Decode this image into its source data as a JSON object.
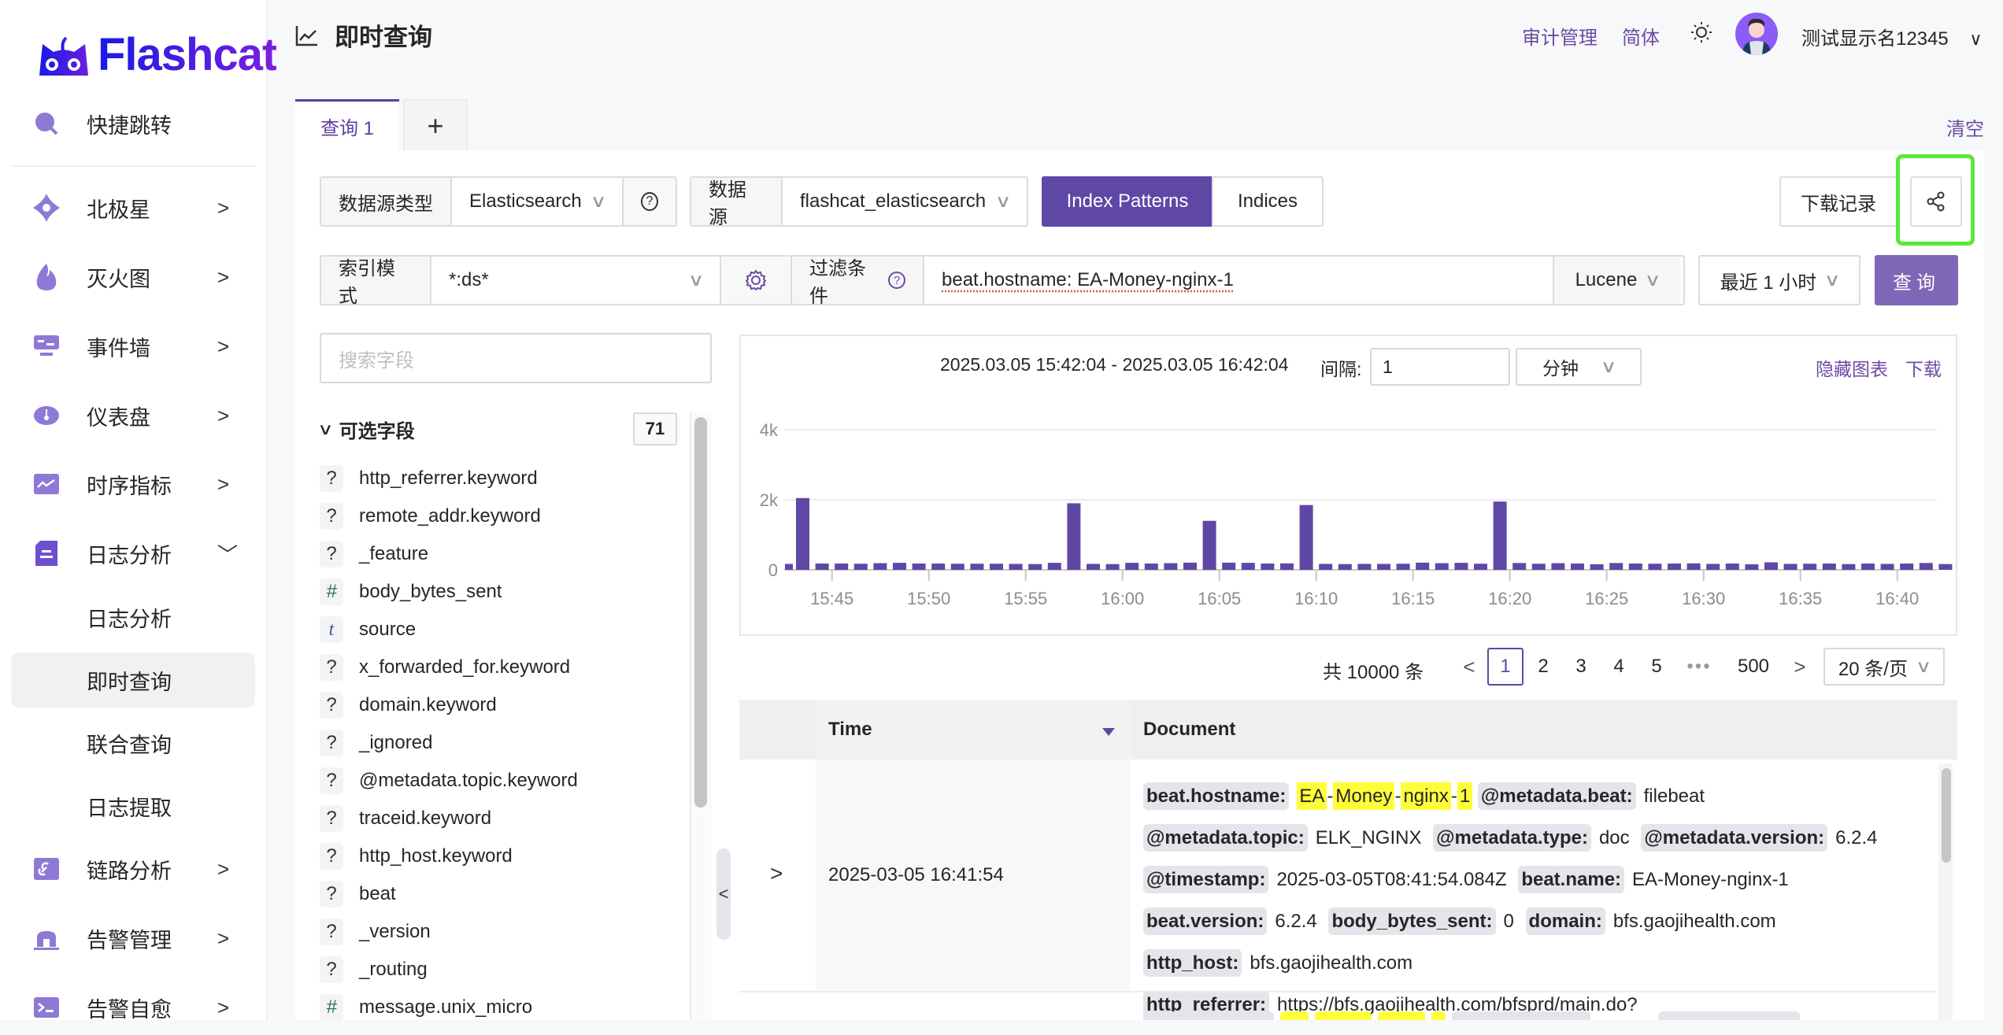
{
  "brand": {
    "name": "Flashcat"
  },
  "sidebar": {
    "items": [
      {
        "label": "快捷跳转",
        "icon": "search-icon"
      },
      {
        "label": "北极星",
        "icon": "polestar-icon",
        "chevron": ">"
      },
      {
        "label": "灭火图",
        "icon": "flame-icon",
        "chevron": ">"
      },
      {
        "label": "事件墙",
        "icon": "event-wall-icon",
        "chevron": ">"
      },
      {
        "label": "仪表盘",
        "icon": "dashboard-icon",
        "chevron": ">"
      },
      {
        "label": "时序指标",
        "icon": "metrics-icon",
        "chevron": ">"
      },
      {
        "label": "日志分析",
        "icon": "log-icon",
        "chevron": "﹀"
      },
      {
        "label": "链路分析",
        "icon": "link-icon",
        "chevron": ">"
      },
      {
        "label": "告警管理",
        "icon": "alarm-icon",
        "chevron": ">"
      },
      {
        "label": "告警自愈",
        "icon": "terminal-icon",
        "chevron": ">"
      }
    ],
    "log_sub_items": [
      {
        "label": "日志分析",
        "active": false
      },
      {
        "label": "即时查询",
        "active": true
      },
      {
        "label": "联合查询",
        "active": false
      },
      {
        "label": "日志提取",
        "active": false
      }
    ]
  },
  "header": {
    "title": "即时查询",
    "audit_link": "审计管理",
    "language": "简体",
    "username": "测试显示名12345",
    "user_chevron": "∨"
  },
  "tabs": {
    "items": [
      {
        "label": "查询 1",
        "active": true
      }
    ],
    "add_label": "+",
    "clear_label": "清空"
  },
  "query": {
    "datasource_type_label": "数据源类型",
    "datasource_type_value": "Elasticsearch",
    "help_icon": "?",
    "datasource_label": "数据源",
    "datasource_value": "flashcat_elasticsearch",
    "mode_options": [
      {
        "label": "Index Patterns",
        "active": true
      },
      {
        "label": "Indices",
        "active": false
      }
    ],
    "download_records_label": "下载记录",
    "share_icon": "share-icon",
    "index_pattern_label": "索引模式",
    "index_pattern_value": "*:ds*",
    "filter_label": "过滤条件",
    "filter_value": "beat.hostname: EA-Money-nginx-1",
    "syntax_value": "Lucene",
    "time_range_value": "最近 1 小时",
    "query_button": "查询"
  },
  "fields": {
    "search_placeholder": "搜索字段",
    "section_label": "可选字段",
    "count": "71",
    "items": [
      {
        "type": "?",
        "type_class": "unk",
        "name": "http_referrer.keyword"
      },
      {
        "type": "?",
        "type_class": "unk",
        "name": "remote_addr.keyword"
      },
      {
        "type": "?",
        "type_class": "unk",
        "name": "_feature"
      },
      {
        "type": "#",
        "type_class": "num",
        "name": "body_bytes_sent"
      },
      {
        "type": "t",
        "type_class": "txt",
        "name": "source"
      },
      {
        "type": "?",
        "type_class": "unk",
        "name": "x_forwarded_for.keyword"
      },
      {
        "type": "?",
        "type_class": "unk",
        "name": "domain.keyword"
      },
      {
        "type": "?",
        "type_class": "unk",
        "name": "_ignored"
      },
      {
        "type": "?",
        "type_class": "unk",
        "name": "@metadata.topic.keyword"
      },
      {
        "type": "?",
        "type_class": "unk",
        "name": "traceid.keyword"
      },
      {
        "type": "?",
        "type_class": "unk",
        "name": "http_host.keyword"
      },
      {
        "type": "?",
        "type_class": "unk",
        "name": "beat"
      },
      {
        "type": "?",
        "type_class": "unk",
        "name": "_version"
      },
      {
        "type": "?",
        "type_class": "unk",
        "name": "_routing"
      },
      {
        "type": "#",
        "type_class": "num",
        "name": "message.unix_micro"
      }
    ]
  },
  "histogram": {
    "range_text": "2025.03.05 15:42:04 - 2025.03.05 16:42:04",
    "interval_label": "间隔:",
    "interval_value": "1",
    "interval_unit": "分钟",
    "hide_chart_label": "隐藏图表",
    "download_label": "下载"
  },
  "chart_data": {
    "type": "bar",
    "title": "",
    "xlabel": "",
    "ylabel": "",
    "ylim": [
      0,
      4000
    ],
    "yticks": [
      "0",
      "2k",
      "4k"
    ],
    "ytick_values": [
      0,
      2000,
      4000
    ],
    "xticks": [
      "15:45",
      "15:50",
      "15:55",
      "16:00",
      "16:05",
      "16:10",
      "16:15",
      "16:20",
      "16:25",
      "16:30",
      "16:35",
      "16:40"
    ],
    "bar_color": "#5f48a5",
    "grid": true,
    "categories": [
      "15:42",
      "15:43",
      "15:44",
      "15:45",
      "15:46",
      "15:47",
      "15:48",
      "15:49",
      "15:50",
      "15:51",
      "15:52",
      "15:53",
      "15:54",
      "15:55",
      "15:56",
      "15:57",
      "15:58",
      "15:59",
      "16:00",
      "16:01",
      "16:02",
      "16:03",
      "16:04",
      "16:05",
      "16:06",
      "16:07",
      "16:08",
      "16:09",
      "16:10",
      "16:11",
      "16:12",
      "16:13",
      "16:14",
      "16:15",
      "16:16",
      "16:17",
      "16:18",
      "16:19",
      "16:20",
      "16:21",
      "16:22",
      "16:23",
      "16:24",
      "16:25",
      "16:26",
      "16:27",
      "16:28",
      "16:29",
      "16:30",
      "16:31",
      "16:32",
      "16:33",
      "16:34",
      "16:35",
      "16:36",
      "16:37",
      "16:38",
      "16:39",
      "16:40",
      "16:41"
    ],
    "values": [
      170,
      2050,
      180,
      180,
      175,
      190,
      200,
      180,
      180,
      175,
      175,
      175,
      170,
      165,
      200,
      1900,
      170,
      165,
      200,
      180,
      190,
      205,
      1400,
      205,
      200,
      180,
      185,
      1850,
      170,
      165,
      170,
      170,
      175,
      205,
      190,
      200,
      175,
      1950,
      195,
      175,
      190,
      180,
      160,
      195,
      180,
      175,
      180,
      185,
      170,
      180,
      160,
      215,
      170,
      175,
      180,
      165,
      180,
      170,
      180,
      195,
      165
    ]
  },
  "pagination": {
    "total_text": "共 10000 条",
    "prev": "<",
    "pages": [
      "1",
      "2",
      "3",
      "4",
      "5"
    ],
    "current": "1",
    "ellipsis": "•••",
    "last": "500",
    "next": ">",
    "page_size": "20 条/页"
  },
  "table": {
    "columns": [
      "Time",
      "Document"
    ],
    "rows": [
      {
        "time": "2025-03-05 16:41:54",
        "document": [
          {
            "k": "beat.hostname:",
            "hl": [
              "EA",
              "Money",
              "nginx",
              "1"
            ]
          },
          {
            "k": "@metadata.beat:",
            "v": "filebeat"
          },
          {
            "k": "@metadata.topic:",
            "v": "ELK_NGINX"
          },
          {
            "k": "@metadata.type:",
            "v": "doc"
          },
          {
            "k": "@metadata.version:",
            "v": "6.2.4"
          },
          {
            "k": "@timestamp:",
            "v": "2025-03-05T08:41:54.084Z"
          },
          {
            "k": "beat.name:",
            "v": "EA-Money-nginx-1"
          },
          {
            "k": "beat.version:",
            "v": "6.2.4"
          },
          {
            "k": "body_bytes_sent:",
            "v": "0"
          },
          {
            "k": "domain:",
            "v": "bfs.gaojihealth.com"
          },
          {
            "k": "http_host:",
            "v": "bfs.gaojihealth.com"
          },
          {
            "k": "http_referrer:",
            "v": "https://bfs.gaojihealth.com/bfsprd/main.do?"
          }
        ]
      }
    ]
  }
}
